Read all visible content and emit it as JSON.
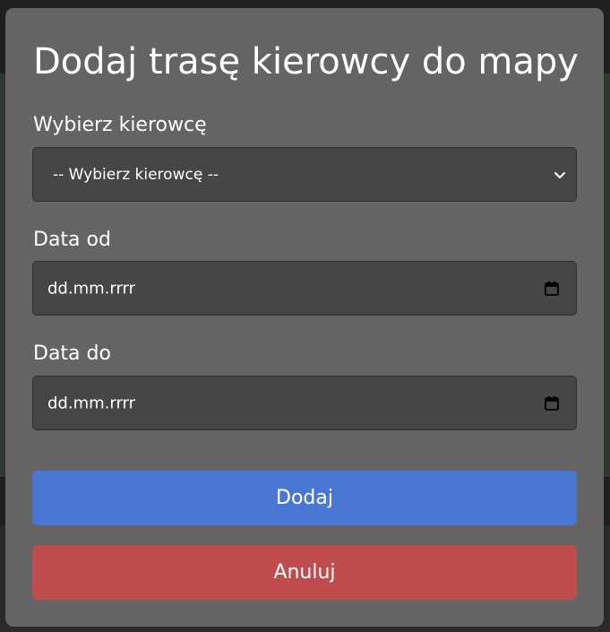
{
  "modal": {
    "title": "Dodaj trasę kierowcy do mapy",
    "driver": {
      "label": "Wybierz kierowcę",
      "selected": "-- Wybierz kierowcę --"
    },
    "date_from": {
      "label": "Data od",
      "value": "dd.mm.rrrr"
    },
    "date_to": {
      "label": "Data do",
      "value": "dd.mm.rrrr"
    },
    "add_label": "Dodaj",
    "cancel_label": "Anuluj"
  },
  "icons": {
    "select": "chevron-down-icon",
    "date": "calendar-icon"
  },
  "colors": {
    "modal_bg": "#656363",
    "field_bg": "#464646",
    "primary": "#4a77d4",
    "danger": "#bf4d4d"
  }
}
